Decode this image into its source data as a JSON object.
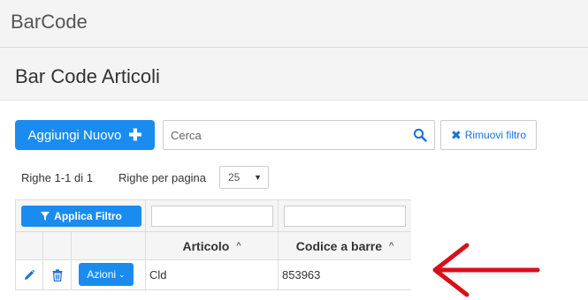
{
  "app": {
    "title": "BarCode"
  },
  "page": {
    "title": "Bar Code Articoli"
  },
  "toolbar": {
    "add_label": "Aggiungi Nuovo",
    "add_icon": "plus-icon",
    "search_placeholder": "Cerca",
    "search_value": "",
    "search_icon": "search-icon",
    "clear_filter_label": "Rimuovi filtro",
    "clear_filter_icon": "times-icon"
  },
  "pagination": {
    "rows_info": "Righe 1-1 di 1",
    "per_page_label": "Righe per pagina",
    "per_page_value": "25"
  },
  "grid": {
    "apply_filter_label": "Applica Filtro",
    "apply_filter_icon": "filter-icon",
    "filters": {
      "articolo": "",
      "codice": ""
    },
    "columns": [
      {
        "label": "Articolo",
        "sort": "asc"
      },
      {
        "label": "Codice a barre",
        "sort": "asc"
      }
    ],
    "rows": [
      {
        "edit_icon": "pencil-icon",
        "delete_icon": "trash-icon",
        "actions_label": "Azioni",
        "articolo": "Cld",
        "codice": "853963"
      }
    ]
  },
  "colors": {
    "primary": "#1a8cf0",
    "link": "#1a72d6",
    "annotation_arrow": "#d8101a",
    "header_bg": "#f4f4f4"
  }
}
